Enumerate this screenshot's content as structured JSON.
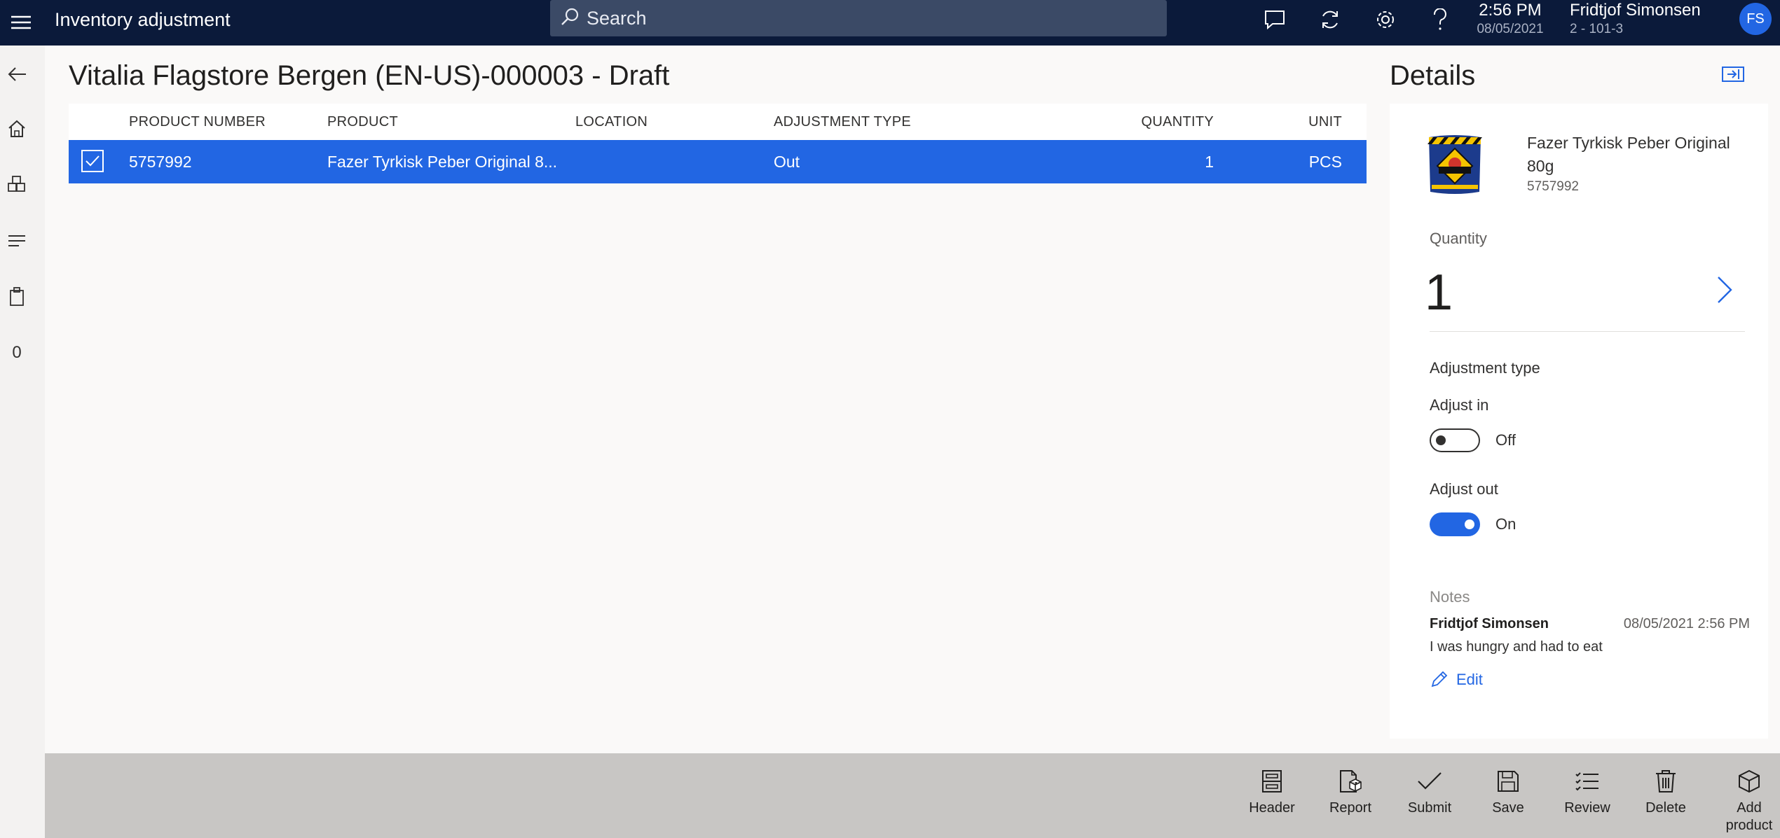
{
  "topbar": {
    "app_title": "Inventory adjustment",
    "search_placeholder": "Search",
    "time": "2:56 PM",
    "date": "08/05/2021",
    "user_name": "Fridtjof Simonsen",
    "store": "2 - 101-3",
    "avatar_initials": "FS",
    "icons": [
      "hamburger-icon",
      "search-icon",
      "chat-icon",
      "refresh-icon",
      "settings-icon",
      "help-icon"
    ]
  },
  "leftnav": {
    "items": [
      "back-icon",
      "home-icon",
      "products-icon",
      "list-icon",
      "clipboard-icon"
    ],
    "count": "0"
  },
  "page": {
    "title": "Vitalia Flagstore Bergen (EN-US)-000003 - Draft"
  },
  "grid": {
    "columns": [
      "PRODUCT NUMBER",
      "PRODUCT",
      "LOCATION",
      "ADJUSTMENT TYPE",
      "QUANTITY",
      "UNIT"
    ],
    "rows": [
      {
        "selected": true,
        "product_number": "5757992",
        "product": "Fazer Tyrkisk Peber Original 8...",
        "location": "",
        "adjustment_type": "Out",
        "quantity": "1",
        "unit": "PCS"
      }
    ]
  },
  "details": {
    "title": "Details",
    "product_name": "Fazer Tyrkisk Peber Original 80g",
    "product_number": "5757992",
    "quantity_label": "Quantity",
    "quantity_value": "1",
    "adjustment_type_label": "Adjustment type",
    "adjust_in_label": "Adjust in",
    "adjust_in_state": "Off",
    "adjust_out_label": "Adjust out",
    "adjust_out_state": "On",
    "notes_label": "Notes",
    "note": {
      "author": "Fridtjof Simonsen",
      "date": "08/05/2021 2:56 PM",
      "text": "I was hungry and had to eat"
    },
    "edit_label": "Edit"
  },
  "appbar": {
    "actions": [
      {
        "label": "Header",
        "icon": "header-icon"
      },
      {
        "label": "Report",
        "icon": "report-icon"
      },
      {
        "label": "Submit",
        "icon": "checkmark-icon"
      },
      {
        "label": "Save",
        "icon": "save-icon"
      },
      {
        "label": "Review",
        "icon": "review-icon"
      },
      {
        "label": "Delete",
        "icon": "delete-icon"
      },
      {
        "label": "Add product",
        "icon": "add-product-icon"
      }
    ]
  },
  "colors": {
    "topbar": "#0b1a3a",
    "accent": "#2266e3",
    "appbar": "#c8c6c4"
  }
}
